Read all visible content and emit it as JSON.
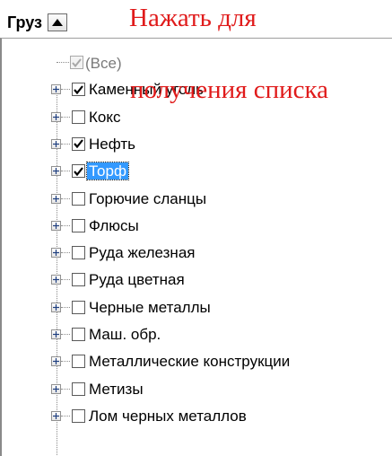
{
  "header": {
    "field_label": "Груз",
    "dropdown_icon": "triangle-up-icon"
  },
  "annotation": {
    "line1": "Нажать для",
    "line2": "получения списка",
    "color": "#e01b1b"
  },
  "filter_list": {
    "all_item": {
      "label": "(Все)",
      "state": "indeterminate-disabled"
    },
    "items": [
      {
        "label": "Каменный уголь",
        "checked": true,
        "selected": false
      },
      {
        "label": "Кокс",
        "checked": false,
        "selected": false
      },
      {
        "label": "Нефть",
        "checked": true,
        "selected": false
      },
      {
        "label": "Торф",
        "checked": true,
        "selected": true
      },
      {
        "label": "Горючие сланцы",
        "checked": false,
        "selected": false
      },
      {
        "label": "Флюсы",
        "checked": false,
        "selected": false
      },
      {
        "label": "Руда железная",
        "checked": false,
        "selected": false
      },
      {
        "label": "Руда цветная",
        "checked": false,
        "selected": false
      },
      {
        "label": "Черные металлы",
        "checked": false,
        "selected": false
      },
      {
        "label": "Маш. обр.",
        "checked": false,
        "selected": false
      },
      {
        "label": "Металлические конструкции",
        "checked": false,
        "selected": false
      },
      {
        "label": "Метизы",
        "checked": false,
        "selected": false
      },
      {
        "label": "Лом черных металлов",
        "checked": false,
        "selected": false
      }
    ],
    "selection_color": "#3399ff"
  }
}
